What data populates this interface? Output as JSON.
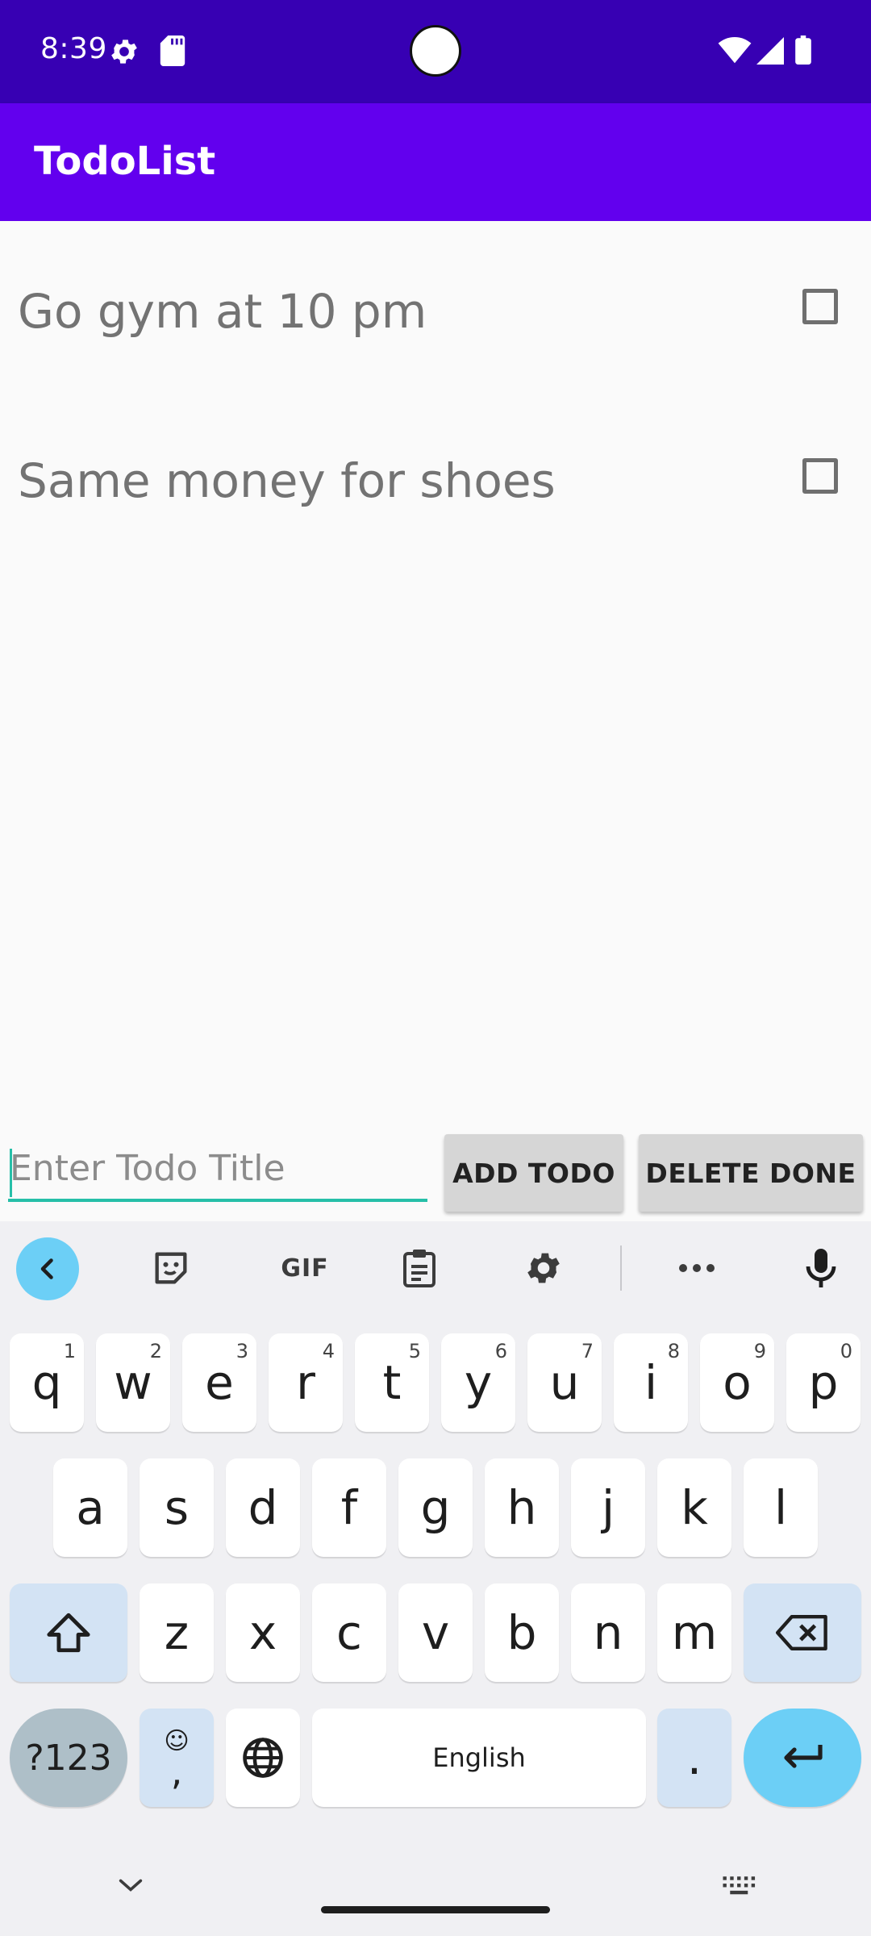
{
  "status_bar": {
    "time": "8:39"
  },
  "app": {
    "title": "TodoList"
  },
  "todos": [
    {
      "text": "Go gym at 10 pm",
      "done": false
    },
    {
      "text": "Same money for shoes",
      "done": false
    }
  ],
  "input": {
    "placeholder": "Enter Todo Title",
    "value": ""
  },
  "buttons": {
    "add": "ADD TODO",
    "delete": "DELETE DONE"
  },
  "keyboard": {
    "toolbar": {
      "gif": "GIF"
    },
    "row1": [
      {
        "key": "q",
        "sup": "1"
      },
      {
        "key": "w",
        "sup": "2"
      },
      {
        "key": "e",
        "sup": "3"
      },
      {
        "key": "r",
        "sup": "4"
      },
      {
        "key": "t",
        "sup": "5"
      },
      {
        "key": "y",
        "sup": "6"
      },
      {
        "key": "u",
        "sup": "7"
      },
      {
        "key": "i",
        "sup": "8"
      },
      {
        "key": "o",
        "sup": "9"
      },
      {
        "key": "p",
        "sup": "0"
      }
    ],
    "row2": [
      "a",
      "s",
      "d",
      "f",
      "g",
      "h",
      "j",
      "k",
      "l"
    ],
    "row3": [
      "z",
      "x",
      "c",
      "v",
      "b",
      "n",
      "m"
    ],
    "symbols_key": "?123",
    "comma_key": ",",
    "space_label": "English",
    "period_key": "."
  },
  "colors": {
    "status_bar": "#3700b3",
    "app_bar": "#6200ee",
    "accent": "#26bfa8",
    "keyboard_accent": "#6ccff6"
  }
}
